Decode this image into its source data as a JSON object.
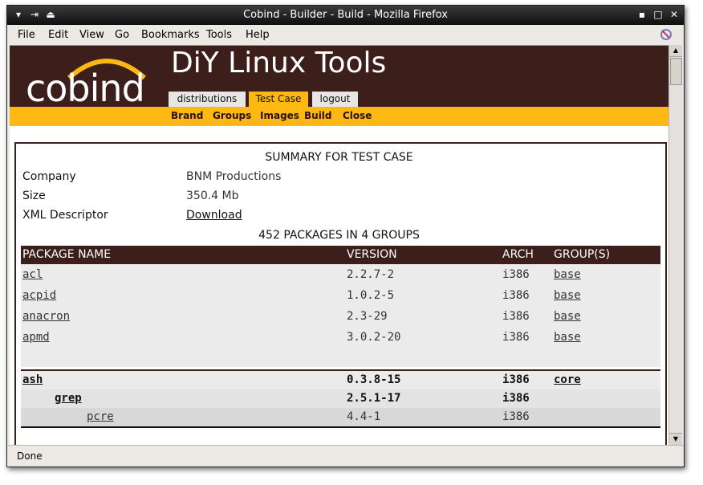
{
  "window": {
    "title": "Cobind - Builder - Build - Mozilla Firefox"
  },
  "menu": [
    "File",
    "Edit",
    "View",
    "Go",
    "Bookmarks",
    "Tools",
    "Help"
  ],
  "site": {
    "logo": "cobind",
    "title": "DiY Linux Tools",
    "tabs": [
      "distributions",
      "Test Case",
      "logout"
    ],
    "active_tab": "Test Case",
    "subnav": [
      "Brand",
      "Groups",
      "Images",
      "Build",
      "Close"
    ]
  },
  "summary": {
    "heading": "SUMMARY FOR TEST CASE",
    "company_label": "Company",
    "company_value": "BNM Productions",
    "size_label": "Size",
    "size_value": "350.4 Mb",
    "xml_label": "XML Descriptor",
    "xml_link": "Download"
  },
  "packages": {
    "heading": "452 PACKAGES IN 4 GROUPS",
    "columns": [
      "PACKAGE NAME",
      "VERSION",
      "ARCH",
      "GROUP(S)"
    ],
    "rows": [
      {
        "name": "acl",
        "version": "2.2.7-2",
        "arch": "i386",
        "group": "base"
      },
      {
        "name": "acpid",
        "version": "1.0.2-5",
        "arch": "i386",
        "group": "base"
      },
      {
        "name": "anacron",
        "version": "2.3-29",
        "arch": "i386",
        "group": "base"
      },
      {
        "name": "apmd",
        "version": "3.0.2-20",
        "arch": "i386",
        "group": "base"
      }
    ],
    "tree": [
      {
        "name": "ash",
        "version": "0.3.8-15",
        "arch": "i386",
        "group": "core"
      },
      {
        "name": "grep",
        "version": "2.5.1-17",
        "arch": "i386",
        "group": ""
      },
      {
        "name": "pcre",
        "version": "4.4-1",
        "arch": "i386",
        "group": ""
      }
    ]
  },
  "status": "Done",
  "colors": {
    "header_bg": "#3c1e1b",
    "accent": "#fdb813"
  }
}
